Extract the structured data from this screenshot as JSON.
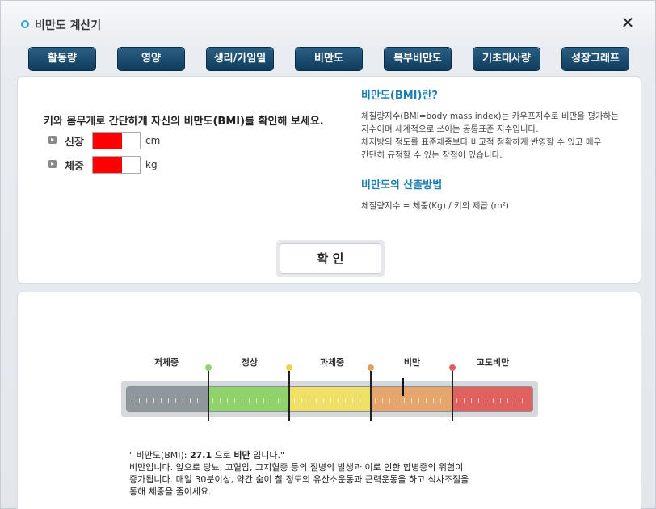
{
  "window": {
    "title": "비만도 계산기",
    "close_label": "✕"
  },
  "tabs": [
    {
      "label": "활동량"
    },
    {
      "label": "영양"
    },
    {
      "label": "생리/가임일"
    },
    {
      "label": "비만도"
    },
    {
      "label": "복부비만도"
    },
    {
      "label": "기초대사량"
    },
    {
      "label": "성장그래프"
    }
  ],
  "form": {
    "intro": "키와 몸무게로 간단하게 자신의 비만도(BMI)를 확인해 보세요.",
    "height": {
      "label": "신장",
      "unit": "cm",
      "value": ""
    },
    "weight": {
      "label": "체중",
      "unit": "kg",
      "value": ""
    },
    "confirm_label": "확 인"
  },
  "info": {
    "title": "비만도(BMI)란?",
    "lines": [
      "체질량지수(BMI=body mass index)는 카우프지수로 비만을 평가하는",
      "지수이며 세계적으로 쓰이는 공통표준 지수입니다.",
      "체지방의 정도를 표준체중보다 비교적 정확하게 반영할 수 있고 매우",
      "간단히 규정할 수 있는 장점이 있습니다."
    ],
    "method_title": "비만도의 산출방법",
    "formula": "체질량지수 = 체중(Kg) / 키의 제곱 (m²)"
  },
  "scale": {
    "categories": [
      "저체중",
      "정상",
      "과체중",
      "비만",
      "고도비만"
    ],
    "colors": [
      "#8f969c",
      "#8fd36a",
      "#efe168",
      "#e6a56a",
      "#e0615d"
    ],
    "marker_colors": [
      "#8fd36a",
      "#efd24a",
      "#dba45a",
      "#e0615d"
    ],
    "bmi_value": 27.1
  },
  "result": {
    "prefix": "\" 비만도(BMI): ",
    "value": "27.1",
    "middle": " 으로 ",
    "category": "비만",
    "suffix": " 입니다.\"",
    "line2": "비만입니다. 앞으로 당뇨, 고혈압, 고지혈증 등의 질병의 발생과 이로 인한 합병증의 위험이",
    "line3": "증가됩니다. 매일 30분이상, 약간 숨이 찰 정도의 유산소운동과 근력운동을 하고 식사조절을",
    "line4": "통해 체중을 줄이세요."
  }
}
